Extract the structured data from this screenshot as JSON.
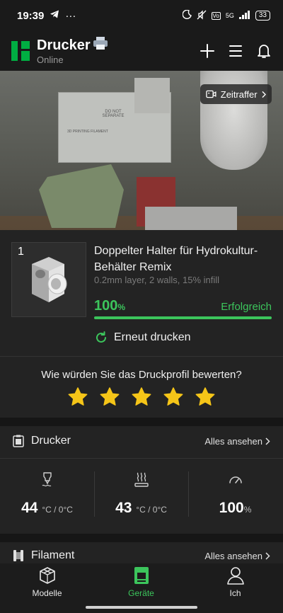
{
  "status_bar": {
    "time": "19:39",
    "battery": "33",
    "signal": "5G"
  },
  "header": {
    "title": "Drucker",
    "subtitle": "Online",
    "actions": [
      "plus-icon",
      "menu-icon",
      "bell-icon"
    ]
  },
  "camera": {
    "timelapse_label": "Zeitraffer",
    "box_label": "DO NOT SEPARATE",
    "box_label2": "3D PRINTING FILAMENT"
  },
  "print_job": {
    "index": "1",
    "name": "Doppelter Halter für Hydrokultur-Behälter Remix",
    "meta": "0.2mm layer, 2 walls, 15% infill",
    "progress_value": "100",
    "progress_unit": "%",
    "progress_fraction": 1.0,
    "status": "Erfolgreich",
    "reprint_label": "Erneut drucken"
  },
  "rating": {
    "question": "Wie würden Sie das Druckprofil bewerten?",
    "stars": 5
  },
  "printer_section": {
    "title": "Drucker",
    "link": "Alles ansehen",
    "temps": [
      {
        "icon": "nozzle-icon",
        "value": "44",
        "unit": "°C / 0°C"
      },
      {
        "icon": "heatbed-icon",
        "value": "43",
        "unit": "°C / 0°C"
      },
      {
        "icon": "speed-icon",
        "value": "100",
        "unit": "%"
      }
    ]
  },
  "filament_section": {
    "title": "Filament",
    "link": "Alles ansehen"
  },
  "bottom_nav": {
    "items": [
      {
        "label": "Modelle",
        "icon": "models-icon",
        "active": false
      },
      {
        "label": "Geräte",
        "icon": "devices-icon",
        "active": true
      },
      {
        "label": "Ich",
        "icon": "profile-icon",
        "active": false
      }
    ]
  },
  "colors": {
    "accent": "#3cc55c",
    "star": "#f5c518",
    "background": "#1a1a1a",
    "card": "#232323"
  }
}
